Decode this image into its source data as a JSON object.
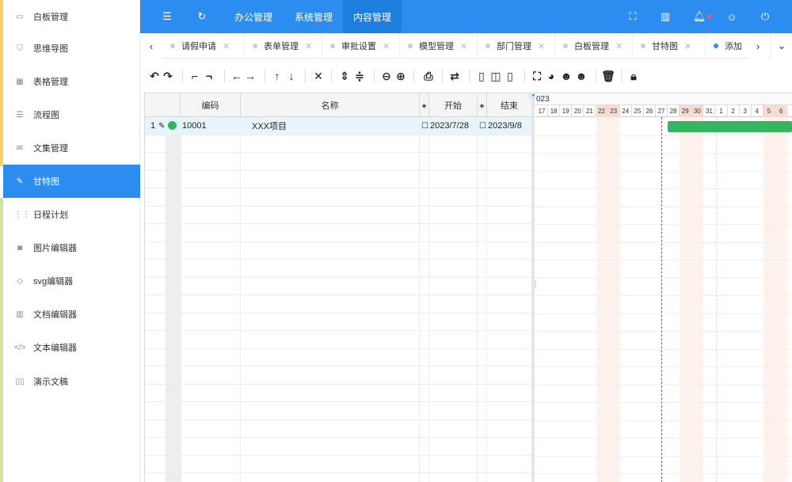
{
  "sidebar": {
    "items": [
      {
        "label": "白板管理",
        "icon": "whiteboard-icon"
      },
      {
        "label": "思维导图",
        "icon": "shield-icon"
      },
      {
        "label": "表格管理",
        "icon": "table-icon"
      },
      {
        "label": "流程图",
        "icon": "flow-icon"
      },
      {
        "label": "文集管理",
        "icon": "mail-icon"
      },
      {
        "label": "甘特图",
        "icon": "gantt-icon",
        "active": true
      },
      {
        "label": "日程计划",
        "icon": "calendar-icon"
      },
      {
        "label": "图片编辑器",
        "icon": "camera-icon"
      },
      {
        "label": "svg编辑器",
        "icon": "diamond-icon"
      },
      {
        "label": "文档编辑器",
        "icon": "book-icon"
      },
      {
        "label": "文本编辑器",
        "icon": "code-icon"
      },
      {
        "label": "演示文稿",
        "icon": "slides-icon"
      }
    ]
  },
  "header": {
    "menus": [
      "办公管理",
      "系统管理",
      "内容管理"
    ],
    "active_menu": "内容管理"
  },
  "tabs": [
    "请假申请",
    "表单管理",
    "审批设置",
    "模型管理",
    "部门管理",
    "白板管理",
    "甘特图",
    "添加"
  ],
  "grid": {
    "headers": {
      "code": "编码",
      "name": "名称",
      "start": "开始",
      "end": "结束"
    },
    "rows": [
      {
        "index": "1",
        "code": "10001",
        "name": "XXX项目",
        "start": "2023/7/28",
        "end": "2023/9/8",
        "status_color": "#35b562"
      }
    ]
  },
  "gantt": {
    "year_label": "023",
    "days": [
      "17",
      "18",
      "19",
      "20",
      "21",
      "22",
      "23",
      "24",
      "25",
      "26",
      "27",
      "28",
      "29",
      "30",
      "31",
      "1",
      "2",
      "3",
      "4",
      "5",
      "6"
    ],
    "weekend_days": [
      "22",
      "23",
      "29",
      "30",
      "5",
      "6"
    ]
  },
  "colors": {
    "primary": "#2d8cf0",
    "bar": "#35b562",
    "today_line": "#e0303a",
    "notify_dot": "#ff5a3c"
  }
}
